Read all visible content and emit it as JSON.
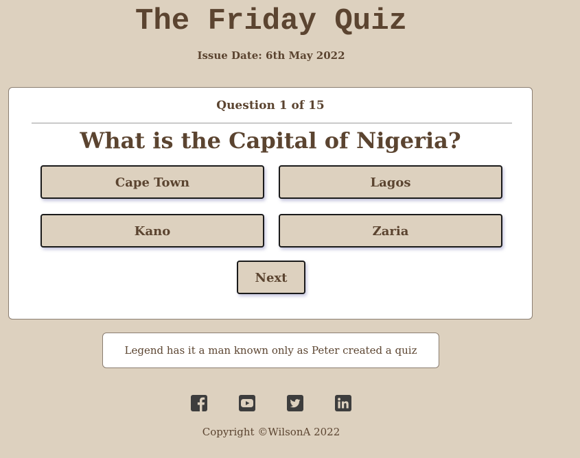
{
  "header": {
    "title": "The Friday Quiz",
    "issue_date": "Issue Date: 6th May 2022"
  },
  "quiz": {
    "counter": "Question 1 of 15",
    "question": "What is the Capital of Nigeria?",
    "answers": [
      "Cape Town",
      "Lagos",
      "Kano",
      "Zaria"
    ],
    "next_label": "Next"
  },
  "legend": {
    "text": "Legend has it a man known only as Peter created a quiz"
  },
  "footer": {
    "socials": [
      "facebook-icon",
      "youtube-icon",
      "twitter-icon",
      "linkedin-icon"
    ],
    "copyright": "Copyright ©WilsonA 2022"
  },
  "colors": {
    "background": "#ddd1bf",
    "text": "#5b4430",
    "card": "#ffffff",
    "icon": "#3d3d3d"
  }
}
